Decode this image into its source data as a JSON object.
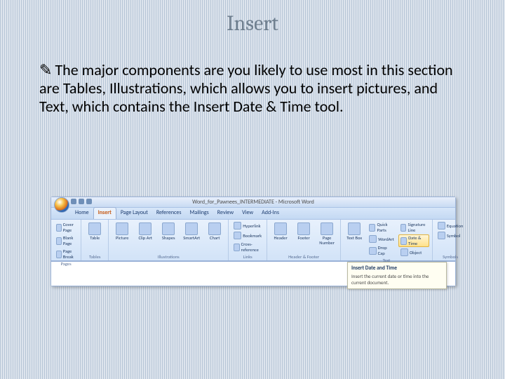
{
  "slide": {
    "title": "Insert",
    "bullet_glyph": "✎",
    "body": "The major components are you likely to use most in this section are Tables, Illustrations, which allows you to insert pictures, and Text, which contains the Insert Date & Time tool."
  },
  "word": {
    "titlebar": "Word_for_Pawnees_INTERMEDIATE - Microsoft Word",
    "tabs": [
      "Home",
      "Insert",
      "Page Layout",
      "References",
      "Mailings",
      "Review",
      "View",
      "Add-Ins"
    ],
    "active_tab_index": 1,
    "groups": {
      "pages": {
        "caption": "Pages",
        "items": [
          "Cover Page",
          "Blank Page",
          "Page Break"
        ]
      },
      "tables": {
        "caption": "Tables",
        "btn": "Table"
      },
      "illustrations": {
        "caption": "Illustrations",
        "btns": [
          "Picture",
          "Clip Art",
          "Shapes",
          "SmartArt",
          "Chart"
        ]
      },
      "links": {
        "caption": "Links",
        "items": [
          "Hyperlink",
          "Bookmark",
          "Cross-reference"
        ]
      },
      "headerfooter": {
        "caption": "Header & Footer",
        "btns": [
          "Header",
          "Footer",
          "Page Number"
        ]
      },
      "text": {
        "caption": "Text",
        "big": "Text Box",
        "items": [
          "Quick Parts",
          "WordArt",
          "Drop Cap"
        ],
        "items2": [
          "Signature Line",
          "Date & Time",
          "Object"
        ]
      },
      "symbols": {
        "caption": "Symbols",
        "items": [
          "Equation",
          "Symbol"
        ]
      }
    },
    "tooltip": {
      "title": "Insert Date and Time",
      "body": "Insert the current date or time into the current document."
    }
  }
}
